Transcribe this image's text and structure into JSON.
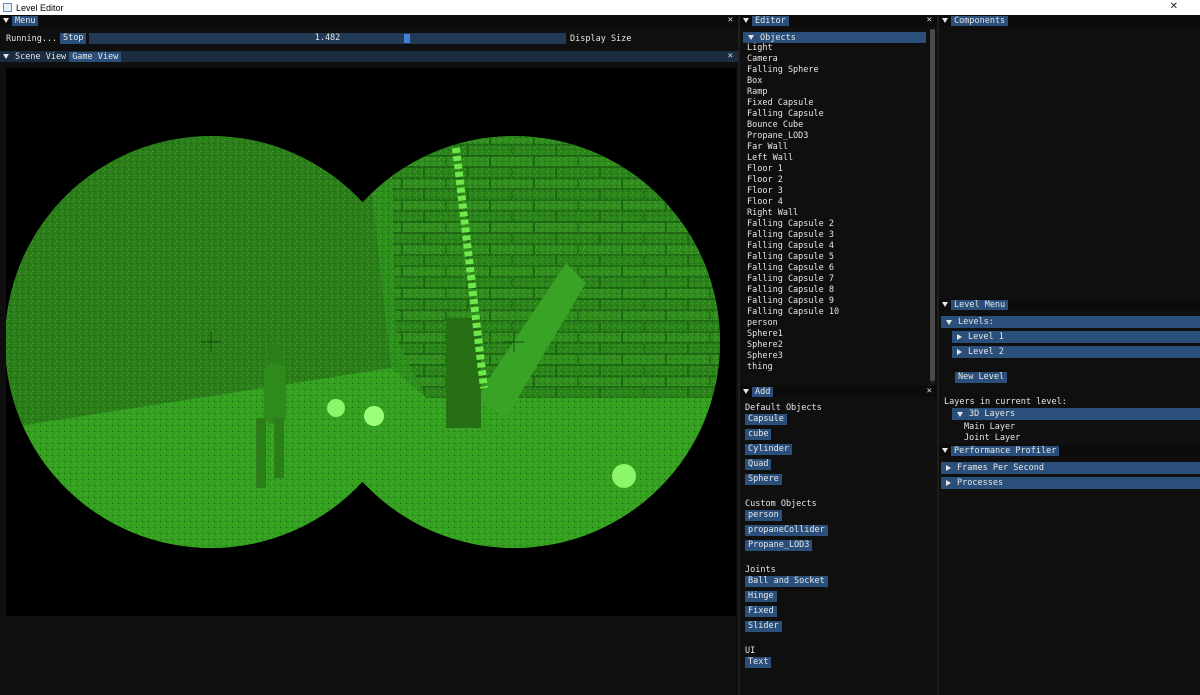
{
  "window": {
    "title": "Level Editor",
    "close_glyph": "✕"
  },
  "menu_panel": {
    "tab": "Menu",
    "status": "Running...",
    "stop_label": "Stop",
    "slider_value": "1.482",
    "slider_label": "Display Size"
  },
  "view_panel": {
    "tabs": [
      "Scene View",
      "Game View"
    ]
  },
  "editor_panel": {
    "tab": "Editor",
    "objects_header": "Objects",
    "objects": [
      "Light",
      "Camera",
      "Falling Sphere",
      "Box",
      "Ramp",
      "Fixed Capsule",
      "Falling Capsule",
      "Bounce Cube",
      "Propane_LOD3",
      "Far Wall",
      "Left Wall",
      "Floor 1",
      "Floor 2",
      "Floor 3",
      "Floor 4",
      "Right Wall",
      "Falling Capsule 2",
      "Falling Capsule 3",
      "Falling Capsule 4",
      "Falling Capsule 5",
      "Falling Capsule 6",
      "Falling Capsule 7",
      "Falling Capsule 8",
      "Falling Capsule 9",
      "Falling Capsule 10",
      "person",
      "Sphere1",
      "Sphere2",
      "Sphere3",
      "thing"
    ]
  },
  "add_panel": {
    "tab": "Add",
    "default_label": "Default Objects",
    "default_objects": [
      "Capsule",
      "cube",
      "Cylinder",
      "Quad",
      "Sphere"
    ],
    "custom_label": "Custom Objects",
    "custom_objects": [
      "person",
      "propaneCollider",
      "Propane_LOD3"
    ],
    "joints_label": "Joints",
    "joints": [
      "Ball and Socket",
      "Hinge",
      "Fixed",
      "Slider"
    ],
    "ui_label": "UI",
    "ui_items": [
      "Text"
    ]
  },
  "components_panel": {
    "tab": "Components"
  },
  "level_menu_panel": {
    "tab": "Level Menu",
    "levels_header": "Levels:",
    "levels": [
      "Level 1",
      "Level 2"
    ],
    "new_level_label": "New Level",
    "layers_label": "Layers in current level:",
    "layers_header": "3D Layers",
    "layers": [
      "Main Layer",
      "Joint Layer"
    ]
  },
  "profiler_panel": {
    "tab": "Performance Profiler",
    "items": [
      "Frames Per Second",
      "Processes"
    ]
  },
  "colors": {
    "accent": "#2a4f7a",
    "night_vision": "#2e9a1f"
  }
}
